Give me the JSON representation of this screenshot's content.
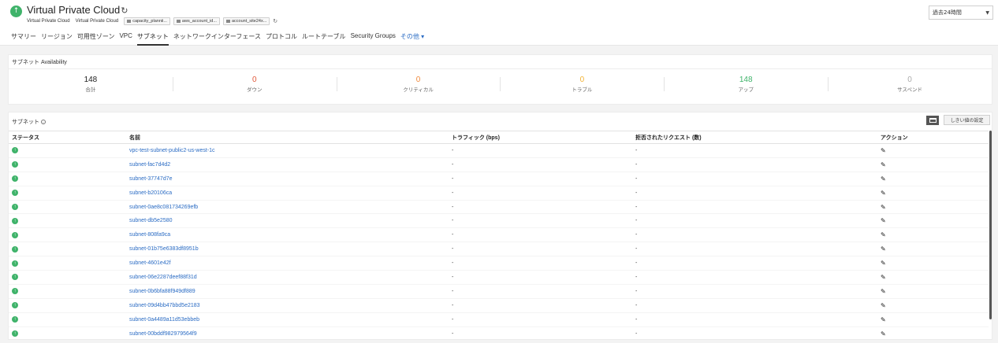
{
  "header": {
    "title": "Virtual Private Cloud",
    "title_refresh_icon": "refresh-icon",
    "breadcrumb": [
      "Virtual Private Cloud",
      "Virtual Private Cloud"
    ],
    "tags": [
      "capacity_plannii...",
      "aws_account_id...",
      "account_site24x..."
    ],
    "status_color": "#3fb36a"
  },
  "tabs": [
    {
      "label": "サマリー"
    },
    {
      "label": "リージョン"
    },
    {
      "label": "可用性ゾーン"
    },
    {
      "label": "VPC"
    },
    {
      "label": "サブネット",
      "active": true
    },
    {
      "label": "ネットワークインターフェース"
    },
    {
      "label": "プロトコル"
    },
    {
      "label": "ルートテーブル"
    },
    {
      "label": "Security Groups"
    },
    {
      "label": "その他 ▾"
    }
  ],
  "time_range": {
    "selected": "過去24時間"
  },
  "availability": {
    "title": "サブネット Availability",
    "stats": [
      {
        "value": "148",
        "label": "合計",
        "color": "#222222"
      },
      {
        "value": "0",
        "label": "ダウン",
        "color": "#e0593b"
      },
      {
        "value": "0",
        "label": "クリティカル",
        "color": "#f08a3e"
      },
      {
        "value": "0",
        "label": "トラブル",
        "color": "#f2b233"
      },
      {
        "value": "148",
        "label": "アップ",
        "color": "#3fb36a"
      },
      {
        "value": "0",
        "label": "サスペンド",
        "color": "#aaaaaa"
      }
    ]
  },
  "subnets": {
    "title": "サブネット",
    "threshold_button": "しきい値の設定",
    "columns": [
      "ステータス",
      "名前",
      "トラフィック (bps)",
      "拒否されたリクエスト (数)",
      "アクション"
    ],
    "rows": [
      {
        "name": "vpc-test-subnet-public2-us-west-1c",
        "traffic": "-",
        "rejected": "-"
      },
      {
        "name": "subnet-fac7d4d2",
        "traffic": "-",
        "rejected": "-"
      },
      {
        "name": "subnet-37747d7e",
        "traffic": "-",
        "rejected": "-"
      },
      {
        "name": "subnet-b20106ca",
        "traffic": "-",
        "rejected": "-"
      },
      {
        "name": "subnet-0ae8c081734269efb",
        "traffic": "-",
        "rejected": "-"
      },
      {
        "name": "subnet-db5e2580",
        "traffic": "-",
        "rejected": "-"
      },
      {
        "name": "subnet-808fa9ca",
        "traffic": "-",
        "rejected": "-"
      },
      {
        "name": "subnet-01b75e6383df8951b",
        "traffic": "-",
        "rejected": "-"
      },
      {
        "name": "subnet-4601e42f",
        "traffic": "-",
        "rejected": "-"
      },
      {
        "name": "subnet-06e2287deef88f31d",
        "traffic": "-",
        "rejected": "-"
      },
      {
        "name": "subnet-0b6bfa88f949df889",
        "traffic": "-",
        "rejected": "-"
      },
      {
        "name": "subnet-09d4bb47bbd5e2183",
        "traffic": "-",
        "rejected": "-"
      },
      {
        "name": "subnet-0a4489a11d53ebbeb",
        "traffic": "-",
        "rejected": "-"
      },
      {
        "name": "subnet-00bddf982979564f9",
        "traffic": "-",
        "rejected": "-"
      }
    ]
  }
}
